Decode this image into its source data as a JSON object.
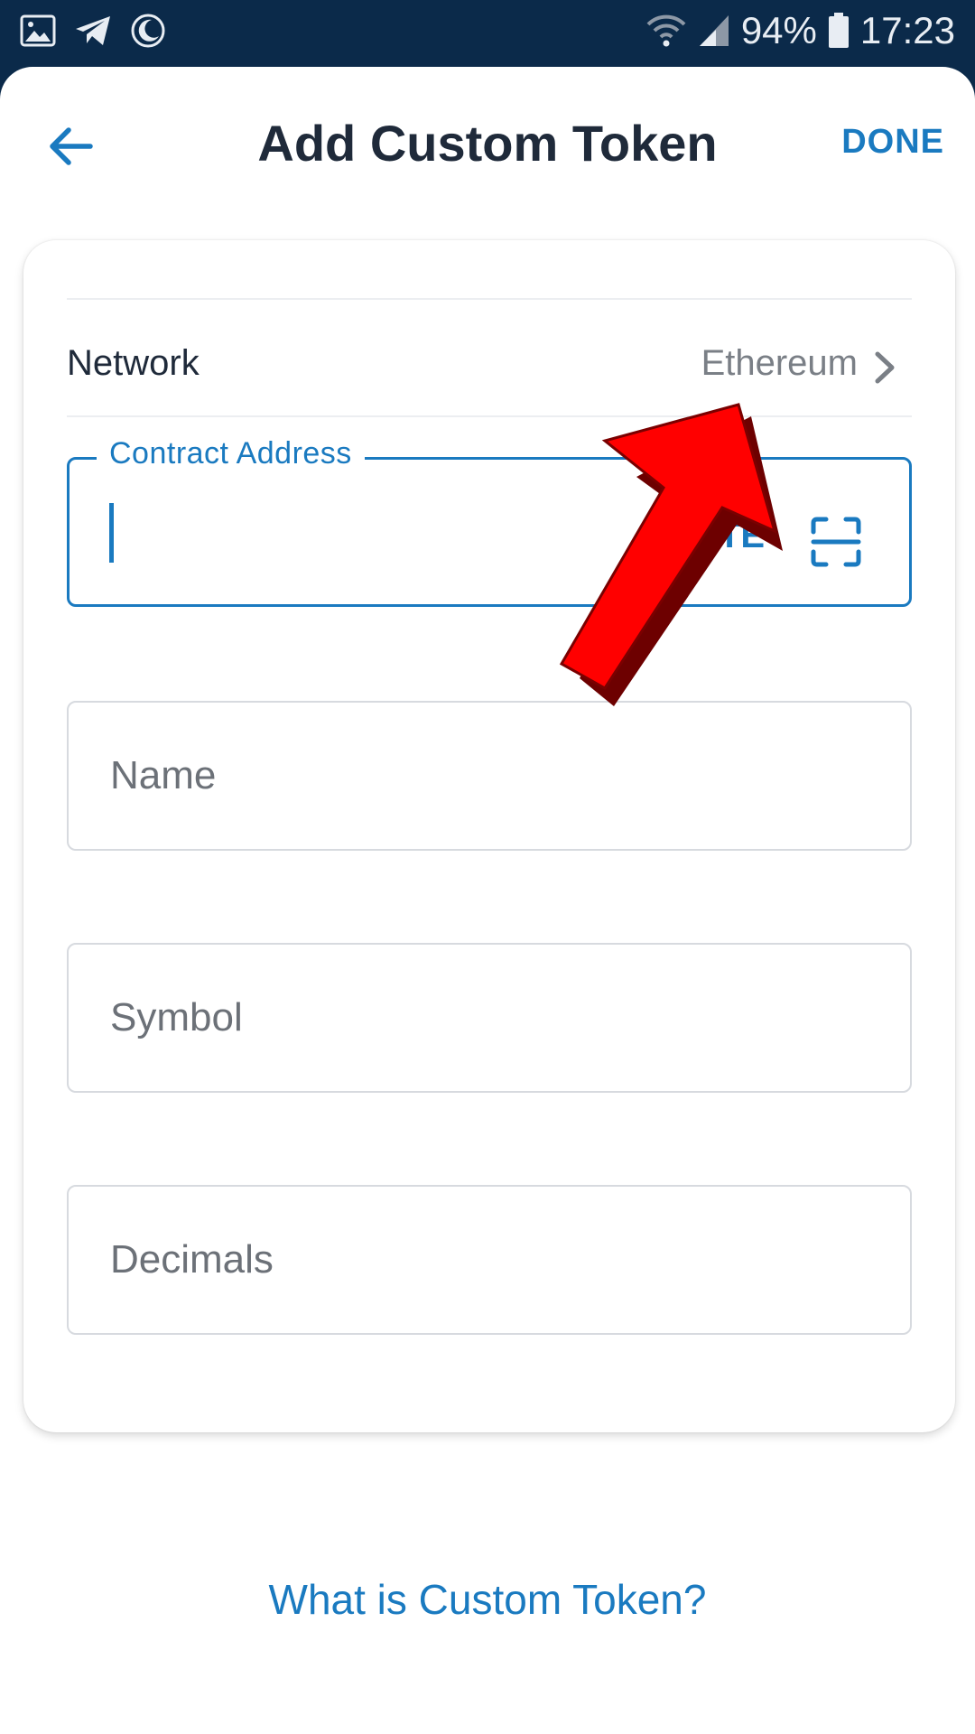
{
  "status_bar": {
    "battery": "94%",
    "time": "17:23",
    "icons": [
      "image-icon",
      "telegram-icon",
      "moon-icon",
      "wifi-icon",
      "signal-icon",
      "battery-icon"
    ]
  },
  "header": {
    "title": "Add Custom Token",
    "done_label": "DONE",
    "back_icon": "arrow-left-icon"
  },
  "network": {
    "label": "Network",
    "value": "Ethereum"
  },
  "contract_address": {
    "label": "Contract Address",
    "value": "",
    "paste_label": "PASTE",
    "scan_icon": "scan-icon"
  },
  "fields": {
    "name": {
      "placeholder": "Name",
      "value": ""
    },
    "symbol": {
      "placeholder": "Symbol",
      "value": ""
    },
    "decimals": {
      "placeholder": "Decimals",
      "value": ""
    }
  },
  "help_link": "What is Custom Token?",
  "colors": {
    "accent": "#1a7ac0",
    "status_bar": "#0b2a4a",
    "title_text": "#1f2a3a",
    "annotation_arrow": "#ff0000"
  }
}
